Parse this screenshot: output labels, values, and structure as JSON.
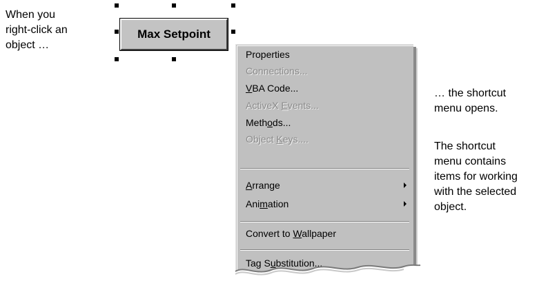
{
  "callouts": {
    "left": [
      "When you",
      "right-click an",
      "object …"
    ],
    "right_top": [
      "… the shortcut",
      "menu opens."
    ],
    "right_bottom": [
      "The shortcut",
      "menu contains",
      "items for working",
      "with the selected",
      "object."
    ]
  },
  "object": {
    "label": "Max Setpoint"
  },
  "context_menu": {
    "items": [
      {
        "label": "Properties",
        "mnemonic": "",
        "enabled": true
      },
      {
        "label": "Connections...",
        "mnemonic": "",
        "enabled": false
      },
      {
        "label": "VBA Code...",
        "mnemonic": "V",
        "enabled": true
      },
      {
        "label": "ActiveX Events...",
        "mnemonic": "E",
        "enabled": false
      },
      {
        "label": "Methods...",
        "mnemonic": "o",
        "enabled": true
      },
      {
        "label": "Object Keys....",
        "mnemonic": "K",
        "enabled": false
      },
      {
        "label": "Arrange",
        "mnemonic": "A",
        "enabled": true,
        "submenu": true
      },
      {
        "label": "Animation",
        "mnemonic": "m",
        "enabled": true,
        "submenu": true
      },
      {
        "label": "Convert to Wallpaper",
        "mnemonic": "W",
        "enabled": true
      },
      {
        "label": "Tag Substitution...",
        "mnemonic": "u",
        "enabled": true
      }
    ]
  },
  "colors": {
    "menu_bg": "#c0c0c0",
    "disabled_text": "#8a8a8a",
    "object_bg": "#c3c3c3"
  }
}
